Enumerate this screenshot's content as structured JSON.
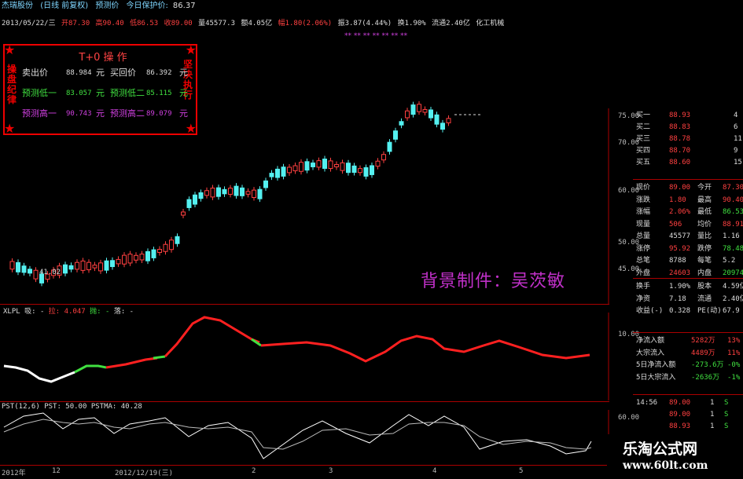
{
  "header": {
    "stock_name": "杰瑞股份",
    "mode": "(日线 前复权)",
    "predict": "预测价",
    "protect_label": "今日保护价:",
    "protect_value": "86.37"
  },
  "infobar": {
    "date": "2013/05/22/三",
    "open": "开87.30",
    "high": "高90.40",
    "low": "低86.53",
    "close": "收89.00",
    "volume": "量45577.3",
    "amount": "额4.05亿",
    "change": "幅1.80(2.06%)",
    "amplitude": "振3.87(4.44%)",
    "turnover": "换1.90%",
    "float": "流通2.40亿",
    "sector": "化工机械",
    "colors": {
      "cyan": "#7fd6ff",
      "red": "#ff4040",
      "white": "#ddd",
      "magenta": "#d040e0"
    }
  },
  "t0_panel": {
    "title": "T+0 操 作",
    "left_vertical": "操盘纪律",
    "right_vertical": "坚决执行",
    "rows": [
      {
        "l_label": "卖出价",
        "l_value": "88.984",
        "l_unit": "元",
        "r_label": "买回价",
        "r_value": "86.392",
        "r_unit": "元"
      },
      {
        "l_label": "预测低一",
        "l_value": "83.057",
        "l_unit": "元",
        "r_label": "预测低二",
        "r_value": "85.115",
        "r_unit": "元"
      },
      {
        "l_label": "预测高一",
        "l_value": "90.743",
        "l_unit": "元",
        "r_label": "预测高二",
        "r_value": "89.079",
        "r_unit": "元"
      }
    ]
  },
  "watermark": "背景制件：吴茨敏",
  "price_axis": [
    "75.00",
    "70.00",
    "60.00",
    "50.00",
    "45.00"
  ],
  "price_low_label": "41.02",
  "indicator1": {
    "name": "XLPL",
    "line1": "吸: -",
    "line2": "拉: 4.047",
    "line3": "抛: -",
    "line4": "落: -",
    "axis": [
      "10.00",
      "0.00"
    ]
  },
  "indicator2": {
    "name": "PST(12,6)",
    "pst": "PST: 50.00",
    "pstma": "PSTMA: 40.28",
    "axis": [
      "60.00"
    ]
  },
  "xaxis": [
    "2012年",
    "12",
    "2012/12/19(三)",
    "2",
    "3",
    "4",
    "5"
  ],
  "order_book": [
    {
      "label": "买一",
      "price": "88.93",
      "vol": "4"
    },
    {
      "label": "买二",
      "price": "88.83",
      "vol": "6"
    },
    {
      "label": "买三",
      "price": "88.78",
      "vol": "11"
    },
    {
      "label": "买四",
      "price": "88.70",
      "vol": "9"
    },
    {
      "label": "买五",
      "price": "88.60",
      "vol": "15"
    }
  ],
  "quote": [
    {
      "l": "现价",
      "lv": "89.00",
      "r": "今开",
      "rv": "87.30"
    },
    {
      "l": "涨跌",
      "lv": "1.80",
      "r": "最高",
      "rv": "90.40"
    },
    {
      "l": "涨幅",
      "lv": "2.06%",
      "r": "最低",
      "rv": "86.53"
    },
    {
      "l": "现量",
      "lv": "506",
      "r": "均价",
      "rv": "88.91"
    },
    {
      "l": "总量",
      "lv": "45577",
      "r": "量比",
      "rv": "1.16"
    },
    {
      "l": "涨停",
      "lv": "95.92",
      "r": "跌停",
      "rv": "78.48"
    },
    {
      "l": "总笔",
      "lv": "8788",
      "r": "每笔",
      "rv": "5.2"
    },
    {
      "l": "外盘",
      "lv": "24603",
      "r": "内盘",
      "rv": "20974"
    }
  ],
  "stats": [
    {
      "l": "换手",
      "lv": "1.90%",
      "r": "股本",
      "rv": "4.59亿"
    },
    {
      "l": "净资",
      "lv": "7.18",
      "r": "流通",
      "rv": "2.40亿"
    },
    {
      "l": "收益(-)",
      "lv": "0.328",
      "r": "PE(动)",
      "rv": "67.9"
    }
  ],
  "flows": [
    {
      "l": "净流入额",
      "v": "5282万",
      "p": "13%"
    },
    {
      "l": "大宗流入",
      "v": "4489万",
      "p": "11%"
    },
    {
      "l": "5日净流入额",
      "v": "-273.6万",
      "p": "-0%"
    },
    {
      "l": "5日大宗流入",
      "v": "-2636万",
      "p": "-1%"
    }
  ],
  "ticks": [
    {
      "t": "14:56",
      "p": "89.00",
      "v": "1",
      "s": "S"
    },
    {
      "t": "",
      "p": "89.00",
      "v": "1",
      "s": "S"
    },
    {
      "t": "",
      "p": "88.93",
      "v": "1",
      "s": "S"
    },
    {
      "t": "",
      "p": "88.90",
      "v": "1",
      "s": "S"
    }
  ],
  "brand": {
    "name": "乐淘公式网",
    "url": "www.60lt.com"
  }
}
